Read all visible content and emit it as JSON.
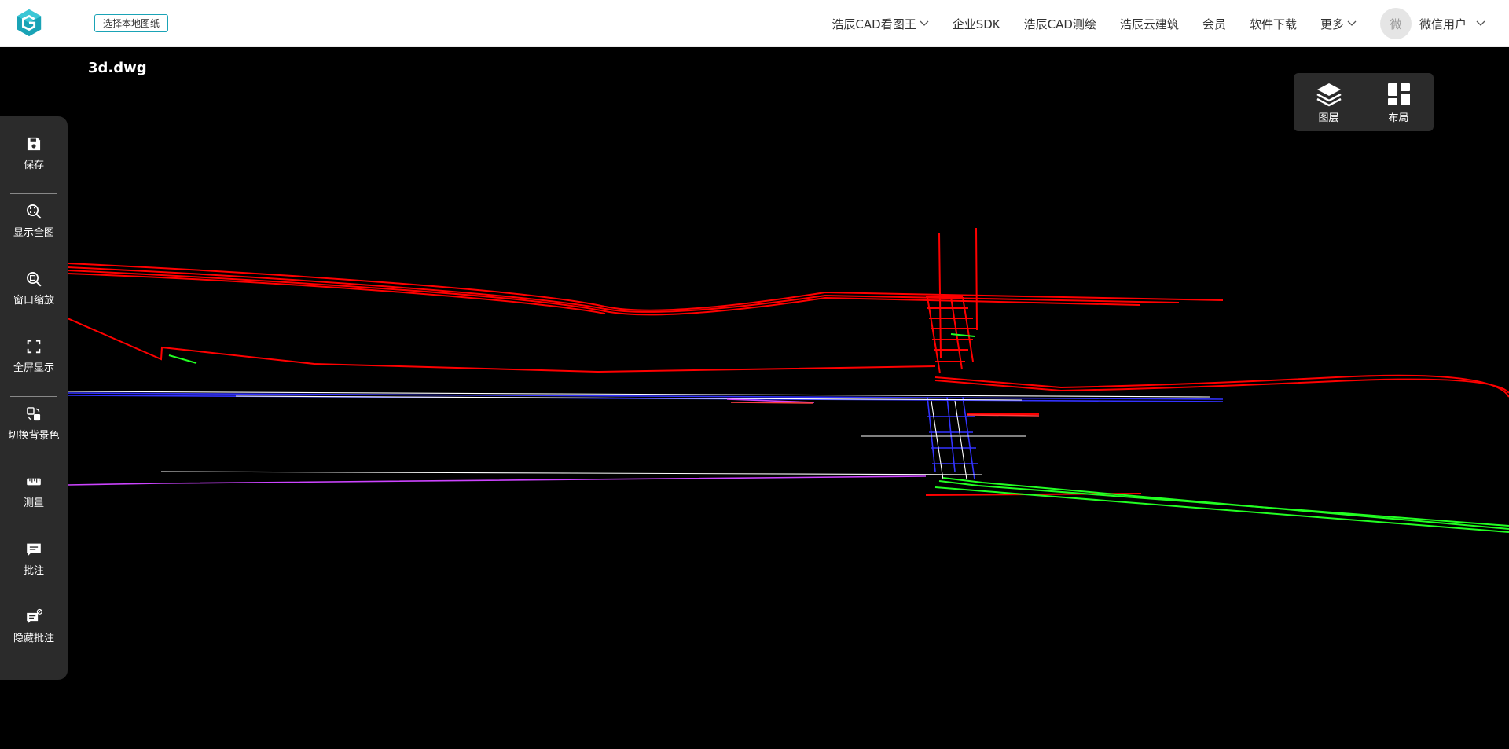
{
  "header": {
    "local_button": "选择本地图纸",
    "nav": [
      {
        "label": "浩辰CAD看图王",
        "has_dropdown": true
      },
      {
        "label": "企业SDK",
        "has_dropdown": false
      },
      {
        "label": "浩辰CAD测绘",
        "has_dropdown": false
      },
      {
        "label": "浩辰云建筑",
        "has_dropdown": false
      },
      {
        "label": "会员",
        "has_dropdown": false
      },
      {
        "label": "软件下载",
        "has_dropdown": false
      },
      {
        "label": "更多",
        "has_dropdown": true
      }
    ],
    "avatar_text": "微",
    "user_name": "微信用户"
  },
  "file": {
    "name": "3d.dwg"
  },
  "right_panel": [
    {
      "label": "图层",
      "icon": "layers-icon"
    },
    {
      "label": "布局",
      "icon": "layout-icon"
    }
  ],
  "toolbar": [
    {
      "label": "保存",
      "icon": "save-icon"
    },
    {
      "label": "显示全图",
      "icon": "zoom-extents-icon"
    },
    {
      "label": "窗口缩放",
      "icon": "zoom-window-icon"
    },
    {
      "label": "全屏显示",
      "icon": "fullscreen-icon"
    },
    {
      "label": "切换背景色",
      "icon": "switch-background-icon"
    },
    {
      "label": "测量",
      "icon": "ruler-icon"
    },
    {
      "label": "批注",
      "icon": "comment-icon"
    },
    {
      "label": "隐藏批注",
      "icon": "hide-comment-icon"
    }
  ],
  "colors": {
    "brand": "#1aa3b6",
    "canvas_bg": "#000000",
    "panel_bg": "#2b2b2b",
    "cad_red": "#ff0000",
    "cad_blue": "#2222ff",
    "cad_green": "#22ff22",
    "cad_magenta": "#cc44ff"
  }
}
